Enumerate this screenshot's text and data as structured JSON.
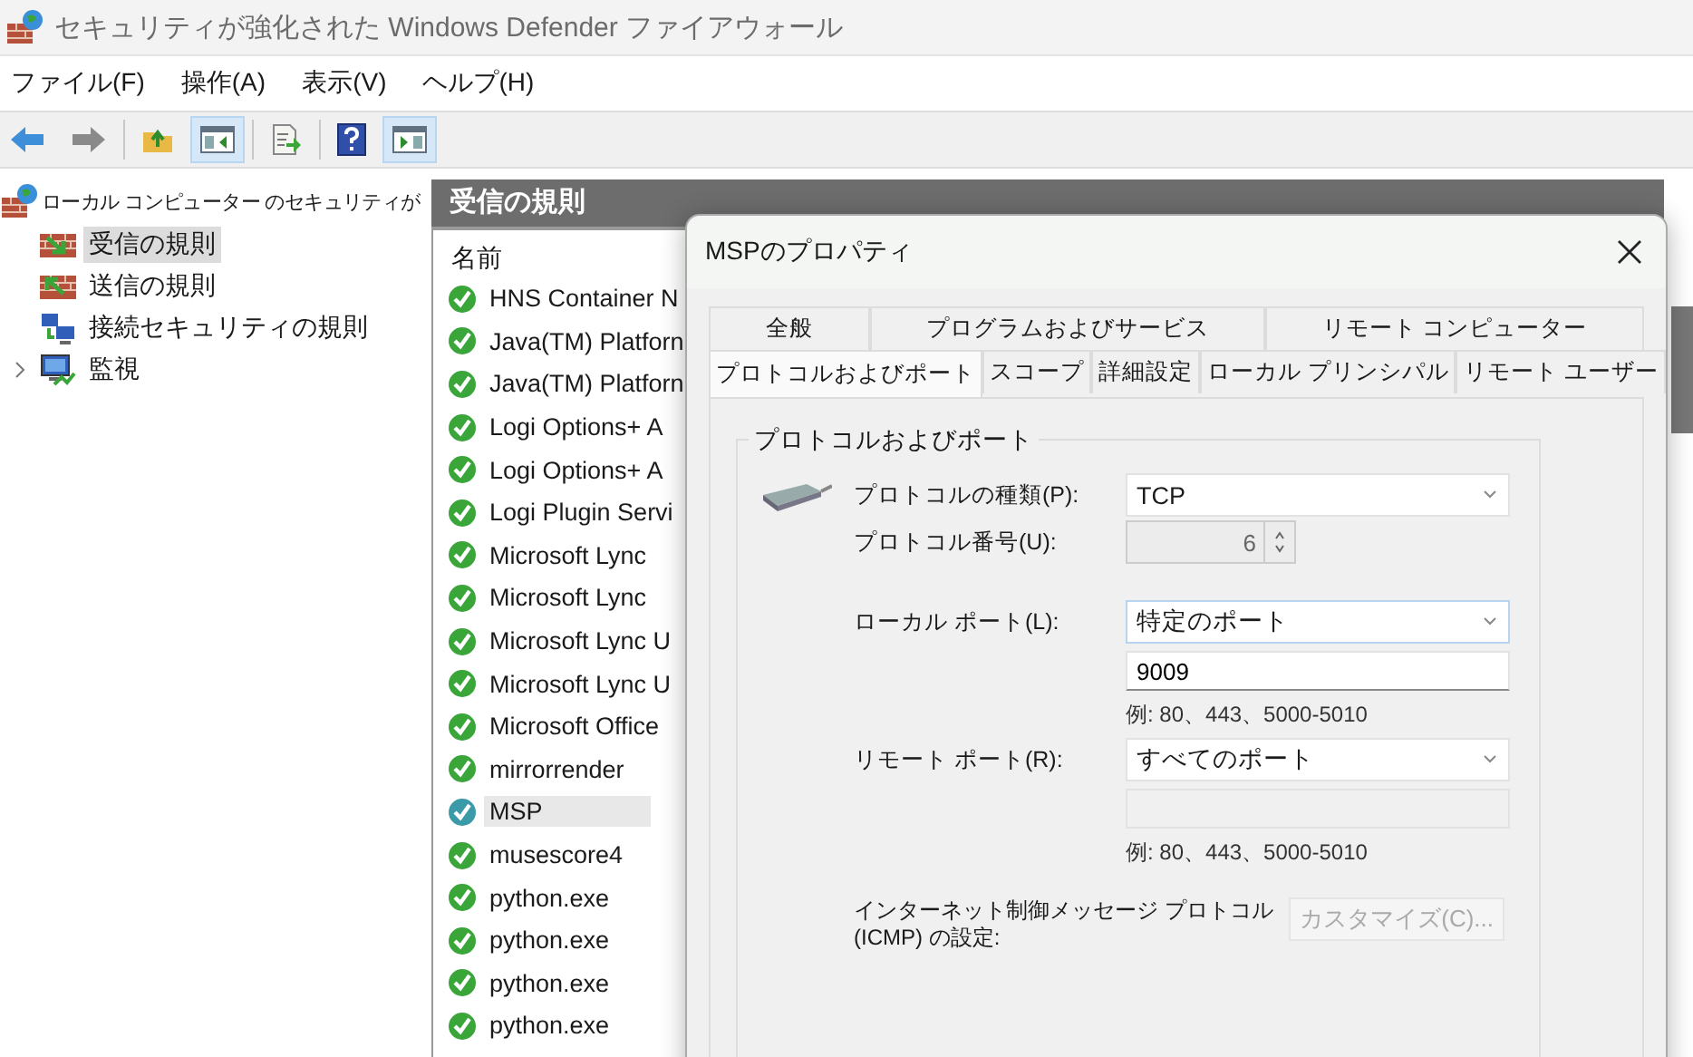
{
  "window": {
    "title": "セキュリティが強化された Windows Defender ファイアウォール"
  },
  "menu": [
    "ファイル(F)",
    "操作(A)",
    "表示(V)",
    "ヘルプ(H)"
  ],
  "toolbar": [
    {
      "kind": "back",
      "pressed": false
    },
    {
      "kind": "forward",
      "pressed": false
    },
    {
      "kind": "up",
      "pressed": false
    },
    {
      "kind": "tree-pane",
      "pressed": true
    },
    {
      "kind": "export",
      "pressed": false
    },
    {
      "kind": "help",
      "pressed": false
    },
    {
      "kind": "action-pane",
      "pressed": true
    }
  ],
  "tree": {
    "root": "ローカル コンピューター のセキュリティが",
    "items": [
      {
        "label": "受信の規則",
        "kind": "inbound",
        "selected": true
      },
      {
        "label": "送信の規則",
        "kind": "outbound",
        "selected": false
      },
      {
        "label": "接続セキュリティの規則",
        "kind": "connection",
        "selected": false
      },
      {
        "label": "監視",
        "kind": "monitor",
        "selected": false,
        "expanded": false
      }
    ]
  },
  "rules_panel": {
    "title": "受信の規則",
    "column": "名前",
    "rows": [
      {
        "name": "HNS Container N",
        "selected": false
      },
      {
        "name": "Java(TM) Platforn",
        "selected": false
      },
      {
        "name": "Java(TM) Platforn",
        "selected": false
      },
      {
        "name": "Logi Options+ A",
        "selected": false
      },
      {
        "name": "Logi Options+ A",
        "selected": false
      },
      {
        "name": "Logi Plugin Servi",
        "selected": false
      },
      {
        "name": "Microsoft Lync",
        "selected": false
      },
      {
        "name": "Microsoft Lync",
        "selected": false
      },
      {
        "name": "Microsoft Lync U",
        "selected": false
      },
      {
        "name": "Microsoft Lync U",
        "selected": false
      },
      {
        "name": "Microsoft Office",
        "selected": false
      },
      {
        "name": "mirrorrender",
        "selected": false
      },
      {
        "name": "MSP",
        "selected": true
      },
      {
        "name": "musescore4",
        "selected": false
      },
      {
        "name": "python.exe",
        "selected": false
      },
      {
        "name": "python.exe",
        "selected": false
      },
      {
        "name": "python.exe",
        "selected": false
      },
      {
        "name": "python.exe",
        "selected": false
      }
    ]
  },
  "dialog": {
    "title": "MSPのプロパティ",
    "tab_rows": [
      [
        {
          "label": "全般",
          "selected": false
        },
        {
          "label": "プログラムおよびサービス",
          "selected": false
        },
        {
          "label": "リモート コンピューター",
          "selected": false
        }
      ],
      [
        {
          "label": "プロトコルおよびポート",
          "selected": true
        },
        {
          "label": "スコープ",
          "selected": false
        },
        {
          "label": "詳細設定",
          "selected": false
        },
        {
          "label": "ローカル プリンシパル",
          "selected": false
        },
        {
          "label": "リモート ユーザー",
          "selected": false
        }
      ]
    ],
    "group": {
      "title": "プロトコルおよびポート",
      "protocol_type": {
        "label": "プロトコルの種類(P):",
        "value": "TCP"
      },
      "protocol_number": {
        "label": "プロトコル番号(U):",
        "value": "6",
        "disabled": true
      },
      "local_port": {
        "label": "ローカル ポート(L):",
        "value": "特定のポート",
        "entry": "9009",
        "entry_disabled": false,
        "hint": "例: 80、443、5000-5010"
      },
      "remote_port": {
        "label": "リモート ポート(R):",
        "value": "すべてのポート",
        "entry_disabled": true,
        "hint": "例: 80、443、5000-5010"
      },
      "icmp": {
        "label_lines": [
          "インターネット制御メッセージ プロトコル",
          "(ICMP) の設定:"
        ],
        "button": "カスタマイズ(C)...",
        "button_disabled": true
      }
    }
  }
}
